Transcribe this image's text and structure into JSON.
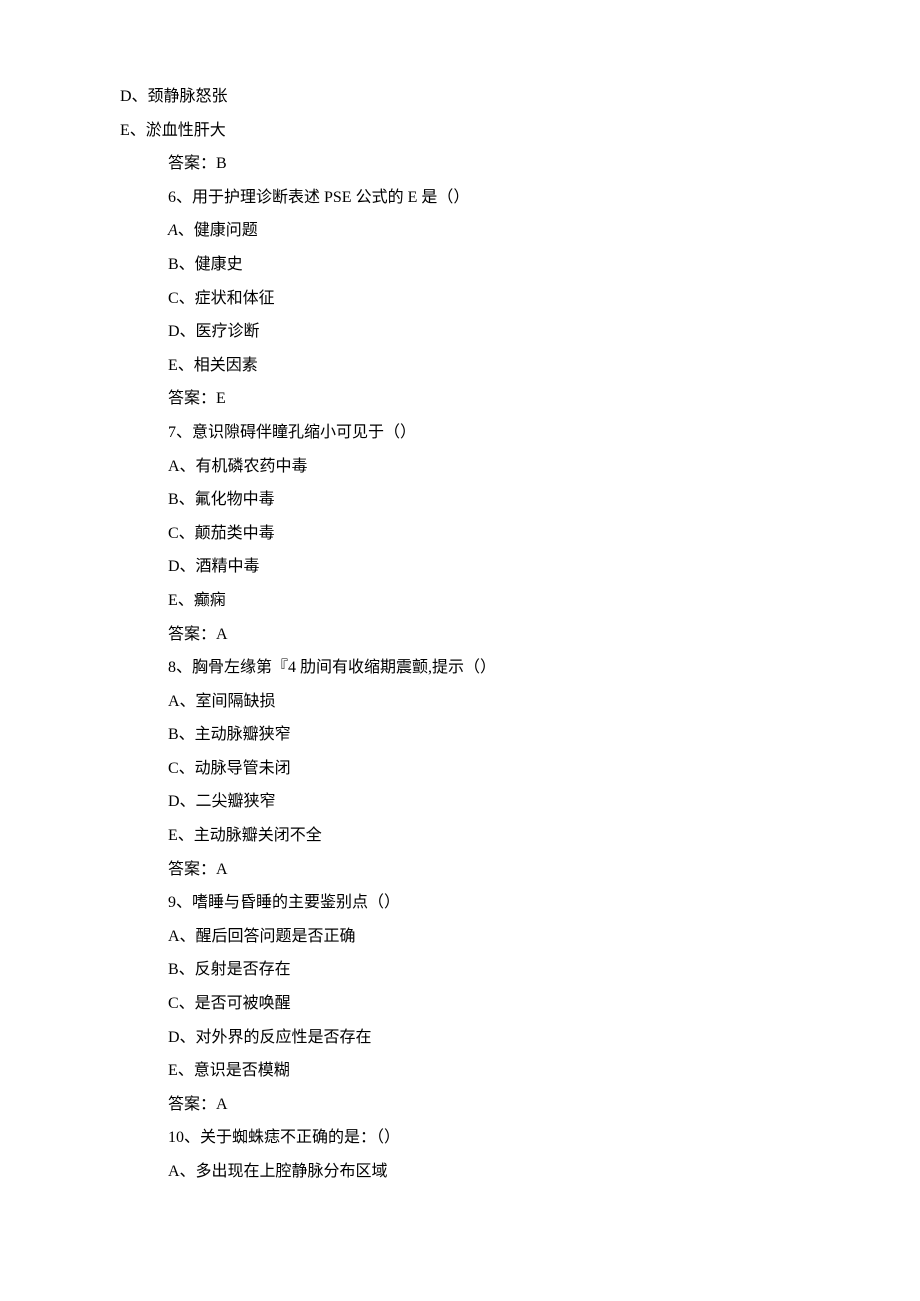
{
  "lines": [
    {
      "indent": "outer",
      "text": "D、颈静脉怒张"
    },
    {
      "indent": "outer",
      "text": "E、淤血性肝大"
    },
    {
      "indent": "inner",
      "text": "答案：B"
    },
    {
      "indent": "inner",
      "text": "6、用于护理诊断表述 PSE 公式的 E 是（）"
    },
    {
      "indent": "inner",
      "prefix": "A",
      "prefixItalic": true,
      "text": "、健康问题"
    },
    {
      "indent": "inner",
      "text": "B、健康史"
    },
    {
      "indent": "inner",
      "text": "C、症状和体征"
    },
    {
      "indent": "inner",
      "text": "D、医疗诊断"
    },
    {
      "indent": "inner",
      "text": "E、相关因素"
    },
    {
      "indent": "inner",
      "text": "答案：E"
    },
    {
      "indent": "inner",
      "text": "7、意识隙碍伴瞳孔缩小可见于（）"
    },
    {
      "indent": "inner",
      "text": "A、有机磷农药中毒"
    },
    {
      "indent": "inner",
      "text": "B、氟化物中毒"
    },
    {
      "indent": "inner",
      "text": "C、颠茄类中毒"
    },
    {
      "indent": "inner",
      "text": "D、酒精中毒"
    },
    {
      "indent": "inner",
      "text": "E、癫痫"
    },
    {
      "indent": "inner",
      "text": "答案：A"
    },
    {
      "indent": "inner",
      "text": "8、胸骨左缘第『4 肋间有收缩期震颤,提示（）"
    },
    {
      "indent": "inner",
      "text": "A、室间隔缺损"
    },
    {
      "indent": "inner",
      "text": "B、主动脉瓣狭窄"
    },
    {
      "indent": "inner",
      "text": "C、动脉导管未闭"
    },
    {
      "indent": "inner",
      "text": "D、二尖瓣狭窄"
    },
    {
      "indent": "inner",
      "text": "E、主动脉瓣关闭不全"
    },
    {
      "indent": "inner",
      "text": "答案：A"
    },
    {
      "indent": "inner",
      "text": "9、嗜睡与昏睡的主要鉴别点（）"
    },
    {
      "indent": "inner",
      "text": "A、醒后回答问题是否正确"
    },
    {
      "indent": "inner",
      "text": "B、反射是否存在"
    },
    {
      "indent": "inner",
      "text": "C、是否可被唤醒"
    },
    {
      "indent": "inner",
      "text": "D、对外界的反应性是否存在"
    },
    {
      "indent": "inner",
      "text": "E、意识是否模糊"
    },
    {
      "indent": "inner",
      "text": "答案：A"
    },
    {
      "indent": "inner",
      "text": "10、关于蜘蛛痣不正确的是：（）"
    },
    {
      "indent": "inner",
      "text": "A、多出现在上腔静脉分布区域"
    }
  ]
}
